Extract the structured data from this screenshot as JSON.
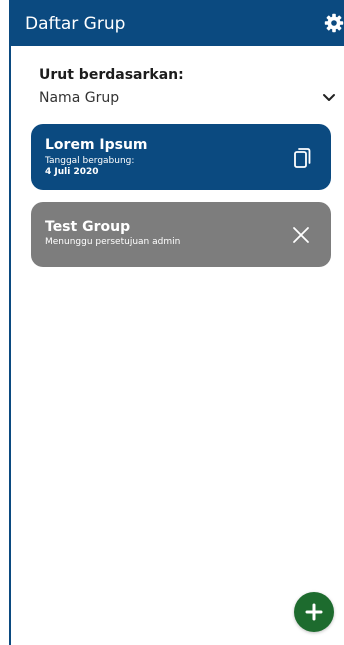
{
  "app_bar": {
    "title": "Daftar Grup",
    "settings_icon": "gear-icon",
    "background": "#0b4a80"
  },
  "sort": {
    "label": "Urut berdasarkan:",
    "selected": "Nama Grup",
    "dropdown_icon": "chevron-down-icon"
  },
  "groups": [
    {
      "name": "Lorem Ipsum",
      "status_label": "Tanggal bergabung:",
      "date": "4 Juli 2020",
      "action_icon": "copy-icon",
      "color": "#0b4a80"
    },
    {
      "name": "Test Group",
      "status_label": "Menunggu persetujuan admin",
      "action_icon": "close-icon",
      "color": "#7d7d7d"
    }
  ],
  "fab": {
    "icon": "plus-icon",
    "color": "#1d6b2e"
  }
}
